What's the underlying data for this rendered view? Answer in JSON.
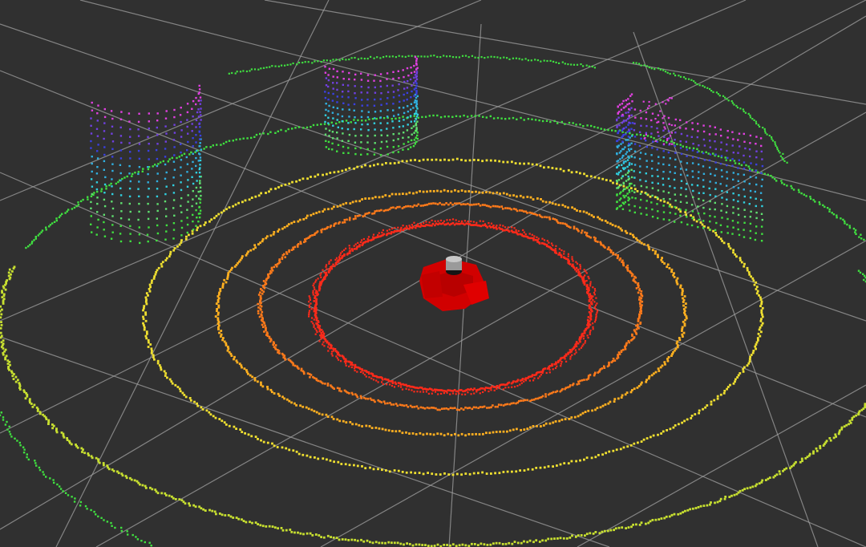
{
  "viewer": {
    "background_color": "#303030",
    "grid_color": "#a0a0a0"
  },
  "scene": {
    "robot": {
      "body_color": "#d10000",
      "sensor_color": "#9a9a9a"
    },
    "scan_colors": {
      "inner_ring": "#ff2a1a",
      "orange_ring": "#ff7a1a",
      "mid_orange_ring": "#ffb020",
      "yellow_ring": "#f0e030",
      "yellow_green_ring": "#c8e030",
      "green": "#40e040",
      "cyan": "#30d0e0",
      "blue": "#3a40e0",
      "magenta": "#e040e0"
    }
  }
}
